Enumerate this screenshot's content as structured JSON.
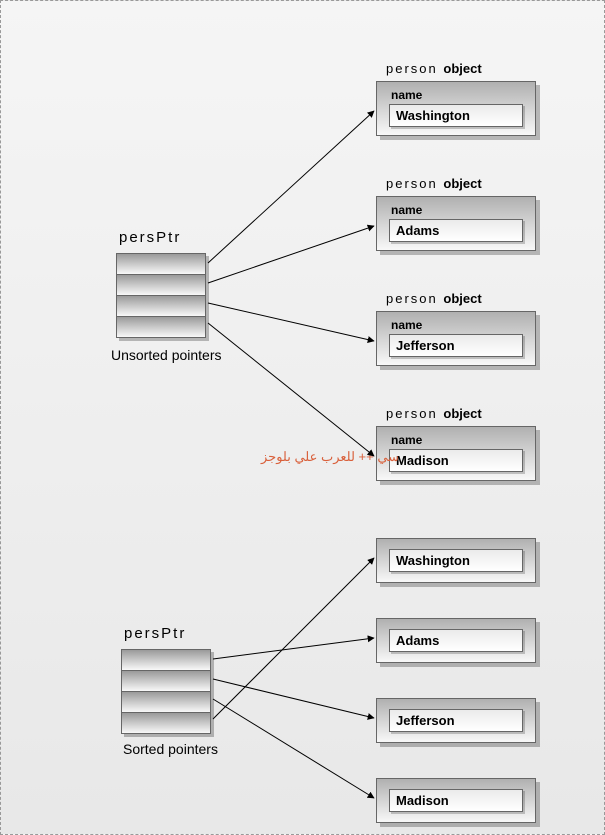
{
  "unsorted": {
    "ptrLabel": "persPtr",
    "caption": "Unsorted pointers",
    "objLabelPrefix": "person",
    "objLabelSuffix": "object",
    "nameLabel": "name",
    "objects": [
      "Washington",
      "Adams",
      "Jefferson",
      "Madison"
    ]
  },
  "sorted": {
    "ptrLabel": "persPtr",
    "caption": "Sorted pointers",
    "objects": [
      "Washington",
      "Adams",
      "Jefferson",
      "Madison"
    ]
  },
  "watermark": "سي ++ للعرب علي بلوجز"
}
